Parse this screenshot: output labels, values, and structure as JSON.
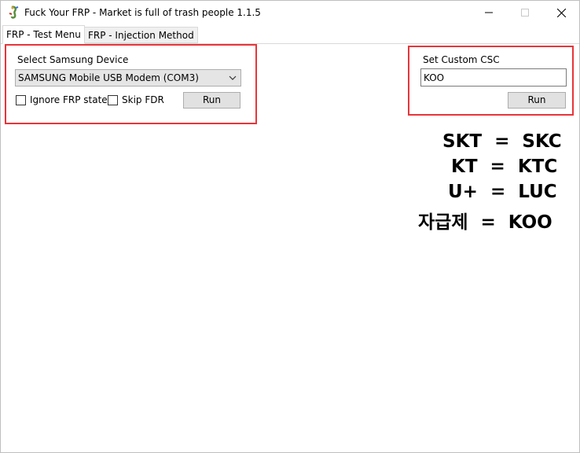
{
  "window": {
    "title": "Fuck Your FRP - Market is full of trash people 1.1.5",
    "app_icon": "seahorse-app-icon",
    "controls": [
      "minimize-icon",
      "maximize-icon",
      "close-icon"
    ]
  },
  "tabs": [
    {
      "label": "FRP - Test Menu",
      "active": true
    },
    {
      "label": "FRP - Injection Method",
      "active": false
    }
  ],
  "device_group": {
    "label": "Select Samsung Device",
    "selected_device": "SAMSUNG Mobile USB Modem (COM3)",
    "ignore_frp_label": "Ignore FRP state",
    "ignore_frp_checked": false,
    "skip_fdr_label": "Skip FDR",
    "skip_fdr_checked": false,
    "run_label": "Run"
  },
  "csc_group": {
    "label": "Set Custom CSC",
    "value": "KOO",
    "run_label": "Run"
  },
  "csc_mappings": [
    {
      "carrier": "SKT",
      "equals": "=",
      "code": "SKC"
    },
    {
      "carrier": "KT",
      "equals": "=",
      "code": "KTC"
    },
    {
      "carrier": "U+",
      "equals": "=",
      "code": "LUC"
    },
    {
      "carrier": "자급제",
      "equals": "=",
      "code": "KOO"
    }
  ],
  "colors": {
    "highlight_border": "#e8353a",
    "button_bg": "#e1e1e1"
  }
}
